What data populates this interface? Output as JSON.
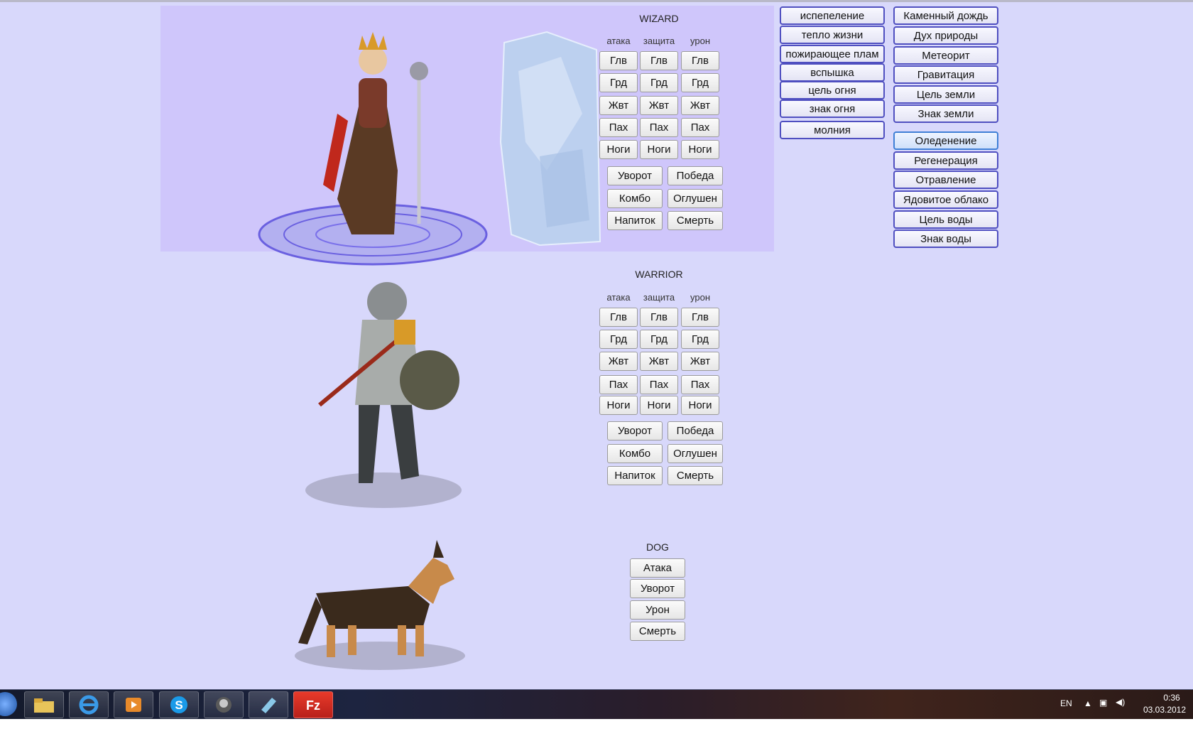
{
  "wizard": {
    "title": "WIZARD",
    "headers": [
      "атака",
      "защита",
      "урон"
    ],
    "rows": [
      "Глв",
      "Грд",
      "Жвт",
      "Пах",
      "Ноги"
    ],
    "actions": [
      "Уворот",
      "Победа",
      "Комбо",
      "Оглушен",
      "Напиток",
      "Смерть"
    ]
  },
  "warrior": {
    "title": "WARRIOR",
    "headers": [
      "атака",
      "защита",
      "урон"
    ],
    "rows": [
      "Глв",
      "Грд",
      "Жвт",
      "Пах",
      "Ноги"
    ],
    "actions": [
      "Уворот",
      "Победа",
      "Комбо",
      "Оглушен",
      "Напиток",
      "Смерть"
    ]
  },
  "dog": {
    "title": "DOG",
    "actions": [
      "Атака",
      "Уворот",
      "Урон",
      "Смерть"
    ]
  },
  "spells_fire": [
    "испепеление",
    "тепло жизни",
    "пожирающее плам",
    "вспышка",
    "цель огня",
    "знак огня",
    "молния"
  ],
  "spells_earth": [
    "Каменный дождь",
    "Дух природы",
    "Метеорит",
    "Гравитация",
    "Цель земли",
    "Знак земли"
  ],
  "spells_water": [
    "Оледенение",
    "Регенерация",
    "Отравление",
    "Ядовитое облако",
    "Цель воды",
    "Знак воды"
  ],
  "taskbar": {
    "apps": [
      "start-orb-icon",
      "file-explorer-icon",
      "internet-explorer-icon",
      "media-player-icon",
      "skype-icon",
      "game-app-icon",
      "notepad-app-icon",
      "filezilla-icon"
    ],
    "lang": "EN",
    "time": "0:36",
    "date": "03.03.2012"
  },
  "colors": {
    "desktop_bg": "#d8d8fb",
    "wizard_panel_bg": "#cfc6fb",
    "spell_border": "#4f4fc0"
  }
}
